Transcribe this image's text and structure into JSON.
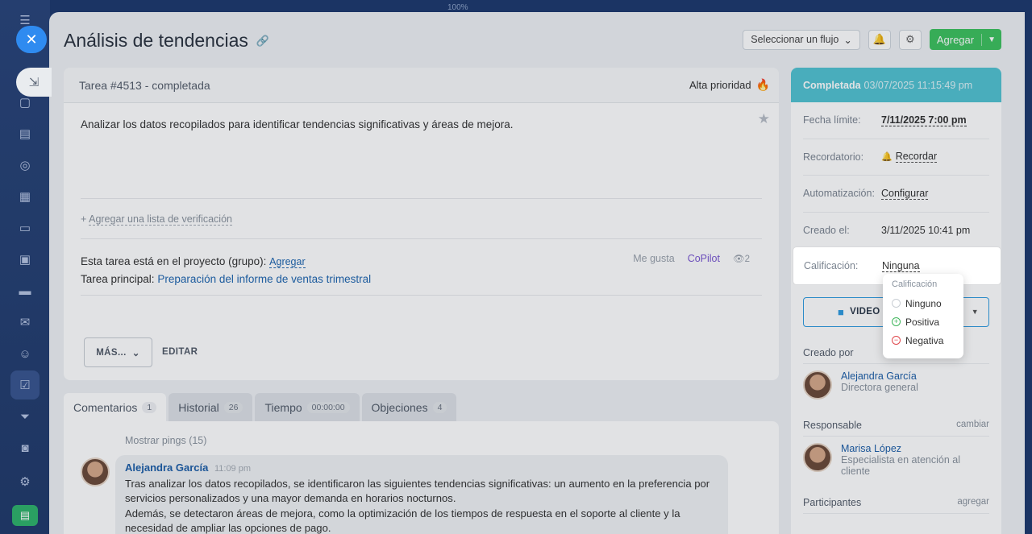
{
  "app": {
    "zoom": "100%"
  },
  "header": {
    "title": "Análisis de tendencias",
    "flow_select": "Seleccionar un flujo",
    "add_label": "Agregar"
  },
  "task": {
    "header": "Tarea #4513 - completada",
    "priority": "Alta prioridad",
    "description": "Analizar los datos recopilados para identificar tendencias significativas y áreas de mejora.",
    "checklist_prefix": "+",
    "checklist_link": "Agregar una lista de verificación",
    "project_label": "Esta tarea está en el proyecto (grupo):",
    "project_action": "Agregar",
    "parent_label": "Tarea principal:",
    "parent_task": "Preparación del informe de ventas trimestral",
    "like": "Me gusta",
    "copilot": "CoPilot",
    "views": "2",
    "more_button": "MÁS...",
    "edit_button": "EDITAR"
  },
  "tabs": [
    {
      "label": "Comentarios",
      "count": "1"
    },
    {
      "label": "Historial",
      "count": "26"
    },
    {
      "label": "Tiempo",
      "count": "00:00:00"
    },
    {
      "label": "Objeciones",
      "count": "4"
    }
  ],
  "comments": {
    "show_pings": "Mostrar pings (15)",
    "items": [
      {
        "author": "Alejandra García",
        "time": "11:09 pm",
        "text1": "Tras analizar los datos recopilados, se identificaron las siguientes tendencias significativas: un aumento en la preferencia por servicios personalizados y una mayor demanda en horarios nocturnos.",
        "text2": "Además, se detectaron áreas de mejora, como la optimización de los tiempos de respuesta en el soporte al cliente y la necesidad de ampliar las opciones de pago."
      }
    ]
  },
  "sidebar": {
    "status": "Completada",
    "status_date": "03/07/2025 11:15:49 pm",
    "rows": [
      {
        "key": "Fecha límite:",
        "value": "7/11/2025 7:00 pm"
      },
      {
        "key": "Recordatorio:",
        "value": "Recordar"
      },
      {
        "key": "Automatización:",
        "value": "Configurar"
      },
      {
        "key": "Creado el:",
        "value": "3/11/2025 10:41 pm"
      },
      {
        "key": "Calificación:",
        "value": "Ninguna"
      }
    ],
    "video_button": "VIDEO",
    "created_by_label": "Creado por",
    "creator": {
      "name": "Alejandra García",
      "role": "Directora general"
    },
    "responsible_label": "Responsable",
    "responsible_action": "cambiar",
    "responsible": {
      "name": "Marisa López",
      "role": "Especialista en atención al cliente"
    },
    "participants_label": "Participantes",
    "participants_action": "agregar"
  },
  "rating_popup": {
    "title": "Calificación",
    "options": [
      "Ninguno",
      "Positiva",
      "Negativa"
    ]
  },
  "colors": {
    "status_header": "#53c3d2",
    "add_button": "#3ec25f",
    "link": "#2067b0",
    "copilot": "#7a57d1"
  }
}
